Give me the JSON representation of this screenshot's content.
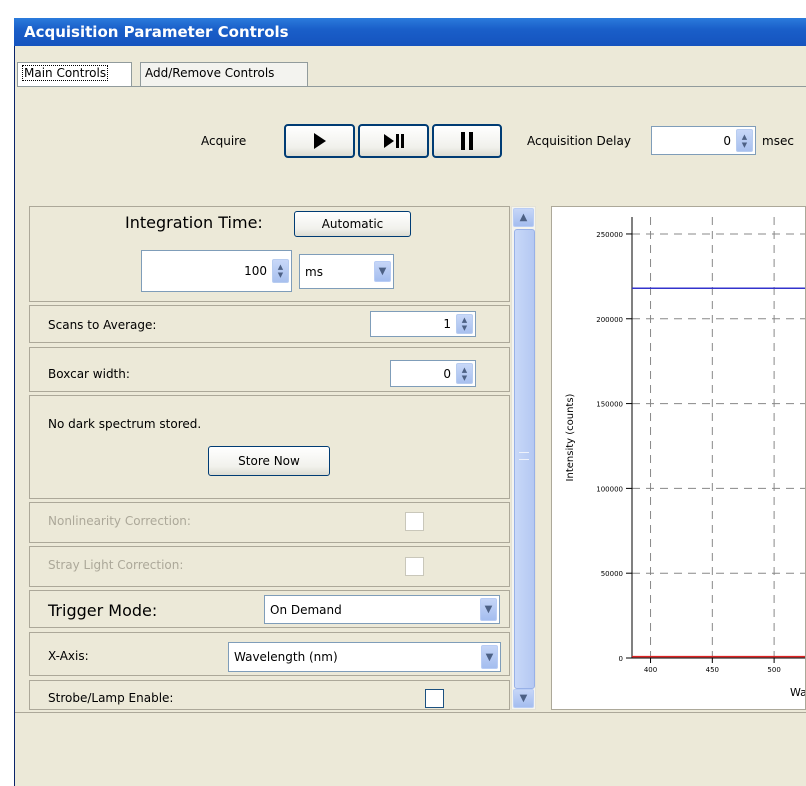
{
  "window": {
    "title": "Acquisition Parameter Controls"
  },
  "tabs": [
    {
      "label": "Main Controls",
      "active": true
    },
    {
      "label": "Add/Remove Controls",
      "active": false
    }
  ],
  "acquire": {
    "label": "Acquire",
    "buttons": [
      {
        "name": "play",
        "icon": "play-icon"
      },
      {
        "name": "play-pause",
        "icon": "play-pause-icon"
      },
      {
        "name": "pause",
        "icon": "pause-icon"
      }
    ],
    "delay_label": "Acquisition Delay",
    "delay_value": "0",
    "delay_unit": "msec"
  },
  "integration": {
    "label": "Integration Time:",
    "auto_label": "Automatic",
    "value": "100",
    "unit": "ms"
  },
  "scans": {
    "label": "Scans to Average:",
    "value": "1"
  },
  "boxcar": {
    "label": "Boxcar width:",
    "value": "0"
  },
  "dark": {
    "message": "No dark spectrum stored.",
    "button": "Store Now"
  },
  "nonlinearity": {
    "label": "Nonlinearity Correction:",
    "checked": false,
    "enabled": false
  },
  "straylight": {
    "label": "Stray Light Correction:",
    "checked": false,
    "enabled": false
  },
  "trigger": {
    "label": "Trigger Mode:",
    "value": "On Demand"
  },
  "xaxis": {
    "label": "X-Axis:",
    "value": "Wavelength (nm)"
  },
  "strobe": {
    "label": "Strobe/Lamp Enable:",
    "checked": false
  },
  "chart_data": {
    "type": "line",
    "ylabel": "Intensity (counts)",
    "xlabel": "Wa",
    "ylim": [
      0,
      260000
    ],
    "xlim": [
      385,
      525
    ],
    "yticks": [
      "250000",
      "200000",
      "150000",
      "100000",
      "50000",
      "0"
    ],
    "ytick_values": [
      250000,
      200000,
      150000,
      100000,
      50000,
      0
    ],
    "xticks": [
      "400",
      "450",
      "500"
    ],
    "xtick_values": [
      400,
      450,
      500
    ],
    "grid": true,
    "series": [
      {
        "color": "#3333cc",
        "x": [
          385,
          525
        ],
        "y": [
          218000,
          218000
        ]
      },
      {
        "color": "#dd2222",
        "x": [
          385,
          525
        ],
        "y": [
          800,
          800
        ]
      }
    ]
  }
}
